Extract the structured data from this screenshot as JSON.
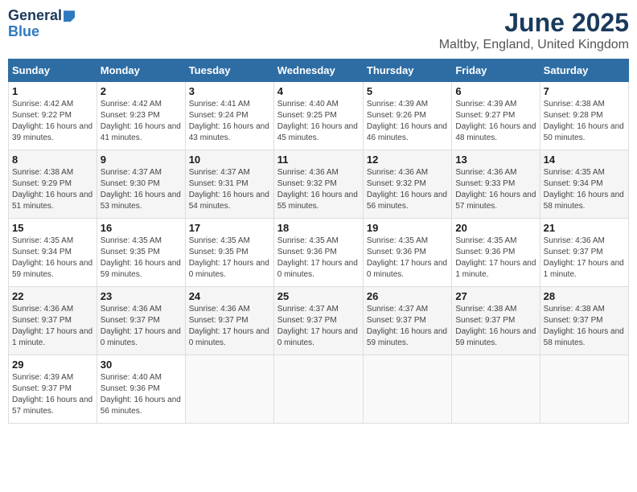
{
  "header": {
    "logo_general": "General",
    "logo_blue": "Blue",
    "month": "June 2025",
    "location": "Maltby, England, United Kingdom"
  },
  "weekdays": [
    "Sunday",
    "Monday",
    "Tuesday",
    "Wednesday",
    "Thursday",
    "Friday",
    "Saturday"
  ],
  "weeks": [
    [
      {
        "day": "1",
        "sunrise": "Sunrise: 4:42 AM",
        "sunset": "Sunset: 9:22 PM",
        "daylight": "Daylight: 16 hours and 39 minutes."
      },
      {
        "day": "2",
        "sunrise": "Sunrise: 4:42 AM",
        "sunset": "Sunset: 9:23 PM",
        "daylight": "Daylight: 16 hours and 41 minutes."
      },
      {
        "day": "3",
        "sunrise": "Sunrise: 4:41 AM",
        "sunset": "Sunset: 9:24 PM",
        "daylight": "Daylight: 16 hours and 43 minutes."
      },
      {
        "day": "4",
        "sunrise": "Sunrise: 4:40 AM",
        "sunset": "Sunset: 9:25 PM",
        "daylight": "Daylight: 16 hours and 45 minutes."
      },
      {
        "day": "5",
        "sunrise": "Sunrise: 4:39 AM",
        "sunset": "Sunset: 9:26 PM",
        "daylight": "Daylight: 16 hours and 46 minutes."
      },
      {
        "day": "6",
        "sunrise": "Sunrise: 4:39 AM",
        "sunset": "Sunset: 9:27 PM",
        "daylight": "Daylight: 16 hours and 48 minutes."
      },
      {
        "day": "7",
        "sunrise": "Sunrise: 4:38 AM",
        "sunset": "Sunset: 9:28 PM",
        "daylight": "Daylight: 16 hours and 50 minutes."
      }
    ],
    [
      {
        "day": "8",
        "sunrise": "Sunrise: 4:38 AM",
        "sunset": "Sunset: 9:29 PM",
        "daylight": "Daylight: 16 hours and 51 minutes."
      },
      {
        "day": "9",
        "sunrise": "Sunrise: 4:37 AM",
        "sunset": "Sunset: 9:30 PM",
        "daylight": "Daylight: 16 hours and 53 minutes."
      },
      {
        "day": "10",
        "sunrise": "Sunrise: 4:37 AM",
        "sunset": "Sunset: 9:31 PM",
        "daylight": "Daylight: 16 hours and 54 minutes."
      },
      {
        "day": "11",
        "sunrise": "Sunrise: 4:36 AM",
        "sunset": "Sunset: 9:32 PM",
        "daylight": "Daylight: 16 hours and 55 minutes."
      },
      {
        "day": "12",
        "sunrise": "Sunrise: 4:36 AM",
        "sunset": "Sunset: 9:32 PM",
        "daylight": "Daylight: 16 hours and 56 minutes."
      },
      {
        "day": "13",
        "sunrise": "Sunrise: 4:36 AM",
        "sunset": "Sunset: 9:33 PM",
        "daylight": "Daylight: 16 hours and 57 minutes."
      },
      {
        "day": "14",
        "sunrise": "Sunrise: 4:35 AM",
        "sunset": "Sunset: 9:34 PM",
        "daylight": "Daylight: 16 hours and 58 minutes."
      }
    ],
    [
      {
        "day": "15",
        "sunrise": "Sunrise: 4:35 AM",
        "sunset": "Sunset: 9:34 PM",
        "daylight": "Daylight: 16 hours and 59 minutes."
      },
      {
        "day": "16",
        "sunrise": "Sunrise: 4:35 AM",
        "sunset": "Sunset: 9:35 PM",
        "daylight": "Daylight: 16 hours and 59 minutes."
      },
      {
        "day": "17",
        "sunrise": "Sunrise: 4:35 AM",
        "sunset": "Sunset: 9:35 PM",
        "daylight": "Daylight: 17 hours and 0 minutes."
      },
      {
        "day": "18",
        "sunrise": "Sunrise: 4:35 AM",
        "sunset": "Sunset: 9:36 PM",
        "daylight": "Daylight: 17 hours and 0 minutes."
      },
      {
        "day": "19",
        "sunrise": "Sunrise: 4:35 AM",
        "sunset": "Sunset: 9:36 PM",
        "daylight": "Daylight: 17 hours and 0 minutes."
      },
      {
        "day": "20",
        "sunrise": "Sunrise: 4:35 AM",
        "sunset": "Sunset: 9:36 PM",
        "daylight": "Daylight: 17 hours and 1 minute."
      },
      {
        "day": "21",
        "sunrise": "Sunrise: 4:36 AM",
        "sunset": "Sunset: 9:37 PM",
        "daylight": "Daylight: 17 hours and 1 minute."
      }
    ],
    [
      {
        "day": "22",
        "sunrise": "Sunrise: 4:36 AM",
        "sunset": "Sunset: 9:37 PM",
        "daylight": "Daylight: 17 hours and 1 minute."
      },
      {
        "day": "23",
        "sunrise": "Sunrise: 4:36 AM",
        "sunset": "Sunset: 9:37 PM",
        "daylight": "Daylight: 17 hours and 0 minutes."
      },
      {
        "day": "24",
        "sunrise": "Sunrise: 4:36 AM",
        "sunset": "Sunset: 9:37 PM",
        "daylight": "Daylight: 17 hours and 0 minutes."
      },
      {
        "day": "25",
        "sunrise": "Sunrise: 4:37 AM",
        "sunset": "Sunset: 9:37 PM",
        "daylight": "Daylight: 17 hours and 0 minutes."
      },
      {
        "day": "26",
        "sunrise": "Sunrise: 4:37 AM",
        "sunset": "Sunset: 9:37 PM",
        "daylight": "Daylight: 16 hours and 59 minutes."
      },
      {
        "day": "27",
        "sunrise": "Sunrise: 4:38 AM",
        "sunset": "Sunset: 9:37 PM",
        "daylight": "Daylight: 16 hours and 59 minutes."
      },
      {
        "day": "28",
        "sunrise": "Sunrise: 4:38 AM",
        "sunset": "Sunset: 9:37 PM",
        "daylight": "Daylight: 16 hours and 58 minutes."
      }
    ],
    [
      {
        "day": "29",
        "sunrise": "Sunrise: 4:39 AM",
        "sunset": "Sunset: 9:37 PM",
        "daylight": "Daylight: 16 hours and 57 minutes."
      },
      {
        "day": "30",
        "sunrise": "Sunrise: 4:40 AM",
        "sunset": "Sunset: 9:36 PM",
        "daylight": "Daylight: 16 hours and 56 minutes."
      },
      null,
      null,
      null,
      null,
      null
    ]
  ]
}
